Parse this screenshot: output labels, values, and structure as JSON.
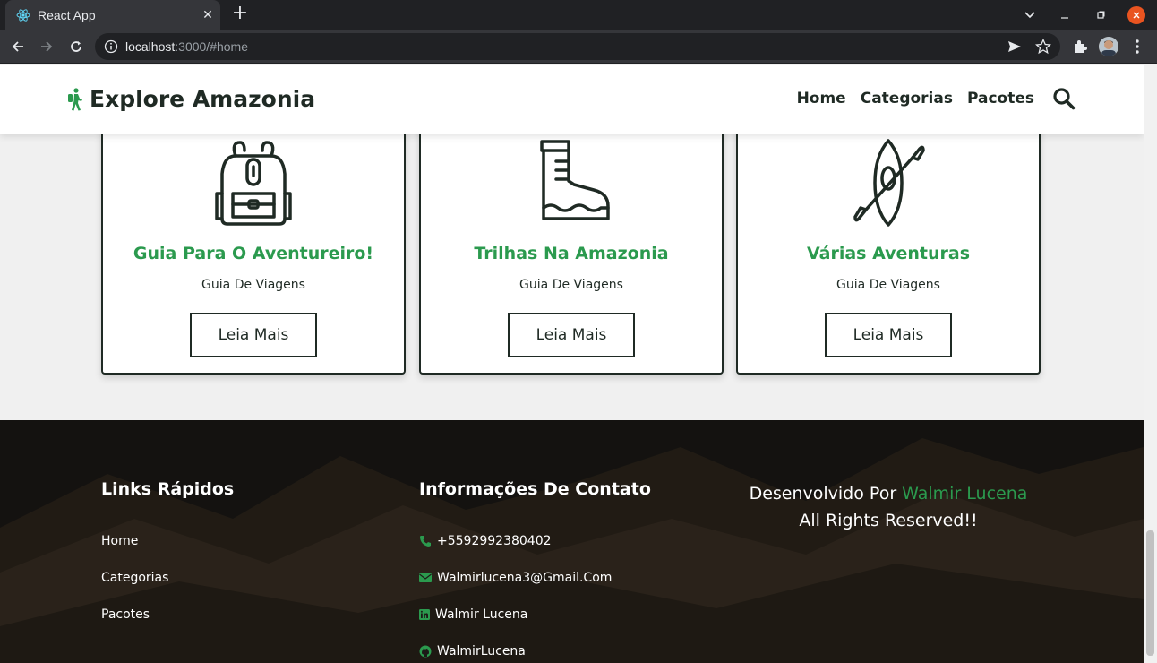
{
  "browser": {
    "tab_title": "React App",
    "tab_close": "✕",
    "new_tab": "+",
    "url_host": "localhost",
    "url_rest": ":3000/#home"
  },
  "header": {
    "logo_text": "Explore Amazonia",
    "nav": [
      "Home",
      "Categorias",
      "Pacotes"
    ]
  },
  "cards": [
    {
      "title": "Guia Para O Aventureiro!",
      "subtitle": "Guia De Viagens",
      "button": "Leia Mais",
      "icon": "backpack-icon"
    },
    {
      "title": "Trilhas Na Amazonia",
      "subtitle": "Guia De Viagens",
      "button": "Leia Mais",
      "icon": "boot-icon"
    },
    {
      "title": "Várias Aventuras",
      "subtitle": "Guia De Viagens",
      "button": "Leia Mais",
      "icon": "kayak-icon"
    }
  ],
  "footer": {
    "links_heading": "Links Rápidos",
    "links": [
      "Home",
      "Categorias",
      "Pacotes"
    ],
    "contact_heading": "Informações De Contato",
    "contacts": [
      {
        "icon": "phone-icon",
        "text": "+5592992380402"
      },
      {
        "icon": "envelope-icon",
        "text": "Walmirlucena3@Gmail.Com"
      },
      {
        "icon": "linkedin-icon",
        "text": "Walmir Lucena"
      },
      {
        "icon": "github-icon",
        "text": "WalmirLucena"
      }
    ],
    "credit_prefix": "Desenvolvido Por ",
    "credit_name": "Walmir Lucena",
    "credit_line2": "All Rights Reserved!!"
  },
  "colors": {
    "accent": "#2b9a4e",
    "dark": "#1f2a24"
  }
}
